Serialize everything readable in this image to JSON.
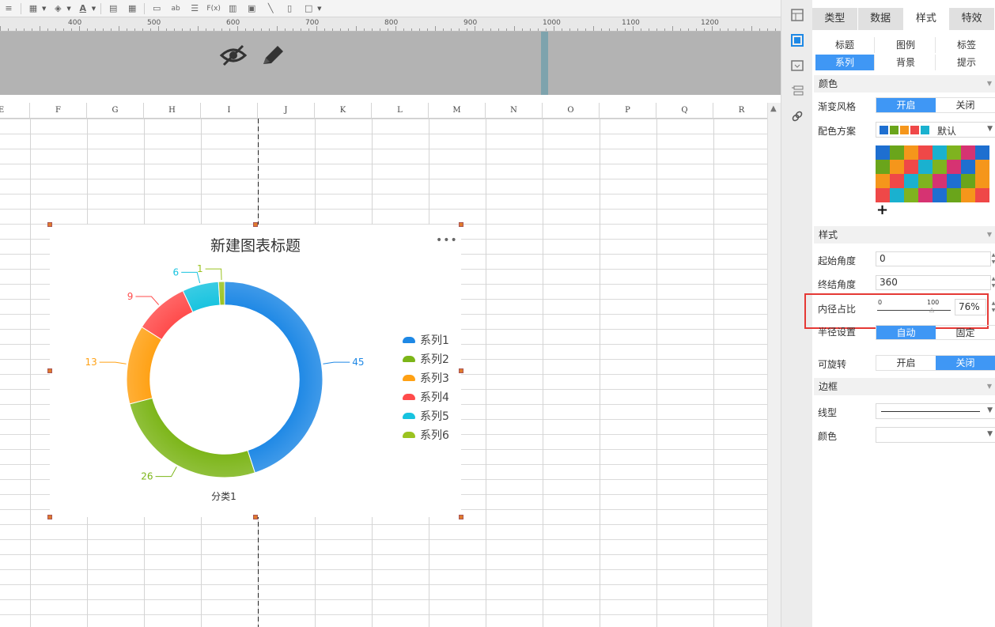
{
  "ruler": {
    "labels": [
      "400",
      "500",
      "600",
      "700",
      "800",
      "900",
      "1000",
      "1100",
      "1200"
    ]
  },
  "sheet": {
    "columns": [
      "E",
      "F",
      "G",
      "H",
      "I",
      "J",
      "K",
      "L",
      "M",
      "N",
      "O",
      "P",
      "Q",
      "R"
    ]
  },
  "chart": {
    "title": "新建图表标题",
    "more": "•••",
    "category_label": "分类1",
    "legend": [
      "系列1",
      "系列2",
      "系列3",
      "系列4",
      "系列5",
      "系列6"
    ],
    "colors": [
      "#1e88e5",
      "#7cb518",
      "#ffa114",
      "#ff4b4b",
      "#17c3df",
      "#9bc320"
    ]
  },
  "chart_data": {
    "type": "pie",
    "title": "新建图表标题",
    "categories": [
      "分类1"
    ],
    "series": [
      {
        "name": "系列1",
        "values": [
          45
        ]
      },
      {
        "name": "系列2",
        "values": [
          26
        ]
      },
      {
        "name": "系列3",
        "values": [
          13
        ]
      },
      {
        "name": "系列4",
        "values": [
          9
        ]
      },
      {
        "name": "系列5",
        "values": [
          6
        ]
      },
      {
        "name": "系列6",
        "values": [
          1
        ]
      }
    ],
    "inner_radius_ratio": 0.76,
    "legend_position": "right"
  },
  "panel": {
    "main_tabs": [
      "类型",
      "数据",
      "样式",
      "特效"
    ],
    "sub_tabs": [
      "标题",
      "图例",
      "标签",
      "系列",
      "背景",
      "提示"
    ],
    "color_section": "颜色",
    "gradient_label": "渐变风格",
    "on": "开启",
    "off": "关闭",
    "scheme_label": "配色方案",
    "scheme_value": "默认",
    "add": "+",
    "style_section": "样式",
    "start_angle_label": "起始角度",
    "start_angle": "0",
    "end_angle_label": "终结角度",
    "end_angle": "360",
    "inner_ratio_label": "内径占比",
    "slider_min": "0",
    "slider_max": "100",
    "inner_ratio_value": "76%",
    "radius_label": "半径设置",
    "auto": "自动",
    "fixed": "固定",
    "rotate_label": "可旋转",
    "border_section": "边框",
    "line_type_label": "线型",
    "border_color_label": "颜色"
  },
  "palette_colors": [
    "#1e6fd0",
    "#6aa51b",
    "#f5961b",
    "#ef4848",
    "#1ab1cf",
    "#7fb31f",
    "#d63372",
    "#1e6fd0",
    "#6aa51b",
    "#f5961b",
    "#ef4848",
    "#1ab1cf",
    "#7fb31f",
    "#d63372",
    "#1e6fd0",
    "#f5961b",
    "#f5961b",
    "#ef4848",
    "#1ab1cf",
    "#7fb31f",
    "#d63372",
    "#1e6fd0",
    "#6aa51b",
    "#f5961b",
    "#ef4848",
    "#1ab1cf",
    "#7fb31f",
    "#d63372",
    "#1e6fd0",
    "#6aa51b",
    "#f5961b",
    "#ef4848"
  ]
}
